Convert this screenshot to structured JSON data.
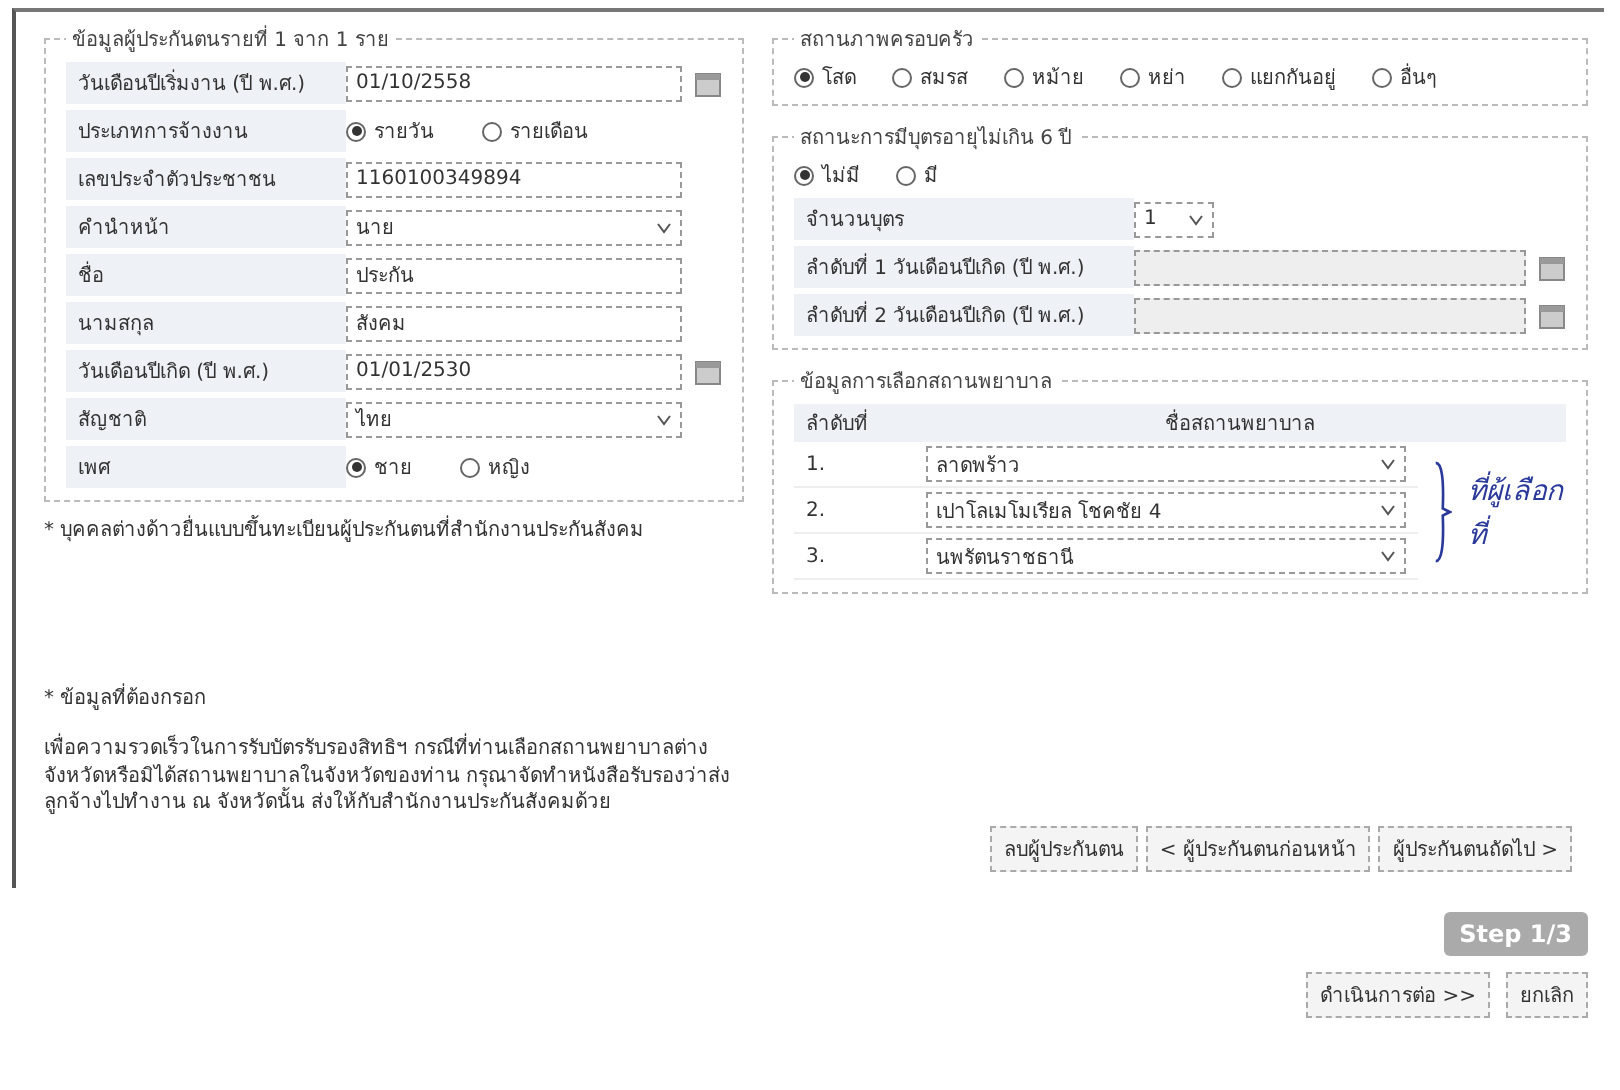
{
  "insured": {
    "legend": "ข้อมูลผู้ประกันตนรายที่ 1 จาก 1 ราย",
    "fields": [
      {
        "kind": "date",
        "label": "วันเดือนปีเริ่มงาน (ปี พ.ศ.)",
        "value": "01/10/2558"
      },
      {
        "kind": "radio",
        "label": "ประเภทการจ้างงาน",
        "options": [
          {
            "label": "รายวัน",
            "selected": true
          },
          {
            "label": "รายเดือน",
            "selected": false
          }
        ]
      },
      {
        "kind": "text",
        "label": "เลขประจำตัวประชาชน",
        "value": "1160100349894"
      },
      {
        "kind": "select",
        "label": "คำนำหน้า",
        "value": "นาย"
      },
      {
        "kind": "text",
        "label": "ชื่อ",
        "value": "ประกัน"
      },
      {
        "kind": "text",
        "label": "นามสกุล",
        "value": "สังคม"
      },
      {
        "kind": "date",
        "label": "วันเดือนปีเกิด (ปี พ.ศ.)",
        "value": "01/01/2530"
      },
      {
        "kind": "select",
        "label": "สัญชาติ",
        "value": "ไทย"
      },
      {
        "kind": "radio",
        "label": "เพศ",
        "options": [
          {
            "label": "ชาย",
            "selected": true
          },
          {
            "label": "หญิง",
            "selected": false
          }
        ]
      }
    ]
  },
  "foreigner_note": "* บุคคลต่างด้าวยื่นแบบขึ้นทะเบียนผู้ประกันตนที่สำนักงานประกันสังคม",
  "required_note": "* ข้อมูลที่ต้องกรอก",
  "hospital_note": "เพื่อความรวดเร็วในการรับบัตรรับรองสิทธิฯ กรณีที่ท่านเลือกสถานพยาบาลต่างจังหวัดหรือมิได้สถานพยาบาลในจังหวัดของท่าน กรุณาจัดทำหนังสือรับรองว่าส่งลูกจ้างไปทำงาน ณ จังหวัดนั้น ส่งให้กับสำนักงานประกันสังคมด้วย",
  "family_status": {
    "legend": "สถานภาพครอบครัว",
    "options": [
      {
        "label": "โสด",
        "selected": true
      },
      {
        "label": "สมรส",
        "selected": false
      },
      {
        "label": "หม้าย",
        "selected": false
      },
      {
        "label": "หย่า",
        "selected": false
      },
      {
        "label": "แยกกันอยู่",
        "selected": false
      },
      {
        "label": "อื่นๆ",
        "selected": false
      }
    ]
  },
  "children": {
    "legend": "สถานะการมีบุตรอายุไม่เกิน 6 ปี",
    "options": [
      {
        "label": "ไม่มี",
        "selected": true
      },
      {
        "label": "มี",
        "selected": false
      }
    ],
    "count_label": "จำนวนบุตร",
    "count": "1",
    "birthdates": [
      {
        "label": "ลำดับที่ 1 วันเดือนปีเกิด (ปี พ.ศ.)",
        "disabled": true
      },
      {
        "label": "ลำดับที่ 2 วันเดือนปีเกิด (ปี พ.ศ.)",
        "disabled": true
      }
    ]
  },
  "hospital": {
    "legend": "ข้อมูลการเลือกสถานพยาบาล",
    "columns": [
      "ลำดับที่",
      "ชื่อสถานพยาบาล"
    ],
    "rows": [
      {
        "no": "1.",
        "name": "ลาดพร้าว"
      },
      {
        "no": "2.",
        "name": "เปาโลเมโมเรียล โชคชัย 4"
      },
      {
        "no": "3.",
        "name": "นพรัตนราชธานี"
      }
    ],
    "annotation": "ที่ผู้เลือกที่"
  },
  "nav_buttons": [
    "ลบผู้ประกันตน",
    "< ผู้ประกันตนก่อนหน้า",
    "ผู้ประกันตนถัดไป >"
  ],
  "step": "Step 1/3",
  "actions": [
    "ดำเนินการต่อ >>",
    "ยกเลิก"
  ]
}
